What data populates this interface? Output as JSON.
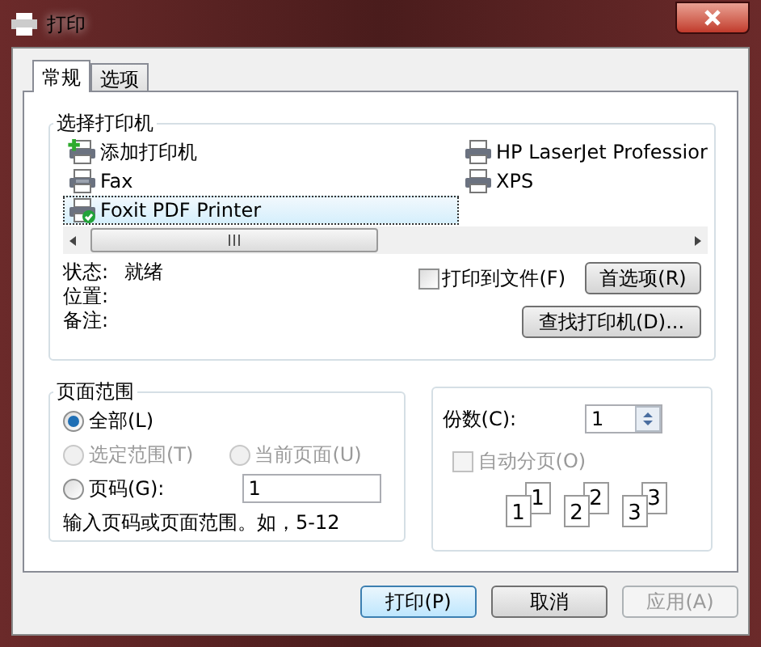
{
  "window": {
    "title": "打印"
  },
  "tabs": [
    {
      "label": "常规",
      "selected": true
    },
    {
      "label": "选项",
      "selected": false
    }
  ],
  "printer_group": {
    "title": "选择打印机",
    "printers": [
      {
        "name": "添加打印机",
        "kind": "add",
        "selected": false
      },
      {
        "name": "Fax",
        "kind": "fax",
        "selected": false
      },
      {
        "name": "Foxit PDF Printer",
        "kind": "pdf",
        "selected": true
      },
      {
        "name": "HP LaserJet Professior",
        "kind": "printer",
        "selected": false
      },
      {
        "name": "XPS",
        "kind": "printer",
        "selected": false
      }
    ],
    "info": [
      {
        "label": "状态:",
        "value": "就绪"
      },
      {
        "label": "位置:"
      },
      {
        "label": "备注:"
      }
    ],
    "print_to_file": {
      "label": "打印到文件(F)",
      "checked": false
    },
    "preferences_button": "首选项(R)",
    "find_button": "查找打印机(D)..."
  },
  "page_range": {
    "title": "页面范围",
    "options": [
      {
        "label": "全部(L)",
        "selected": true,
        "disabled": false
      },
      {
        "label": "选定范围(T)",
        "selected": false,
        "disabled": true
      },
      {
        "label": "当前页面(U)",
        "selected": false,
        "disabled": true
      },
      {
        "label": "页码(G):",
        "selected": false,
        "disabled": false
      }
    ],
    "pages_value": "1",
    "hint": "输入页码或页面范围。如，5-12"
  },
  "copies": {
    "label": "份数(C):",
    "value": "1",
    "collate": {
      "label": "自动分页(O)",
      "checked": false,
      "disabled": true
    },
    "pages": [
      "1",
      "1",
      "2",
      "2",
      "3",
      "3"
    ]
  },
  "buttons": [
    {
      "label": "打印(P)",
      "default": true,
      "disabled": false
    },
    {
      "label": "取消",
      "default": false,
      "disabled": false
    },
    {
      "label": "应用(A)",
      "default": false,
      "disabled": true
    }
  ]
}
